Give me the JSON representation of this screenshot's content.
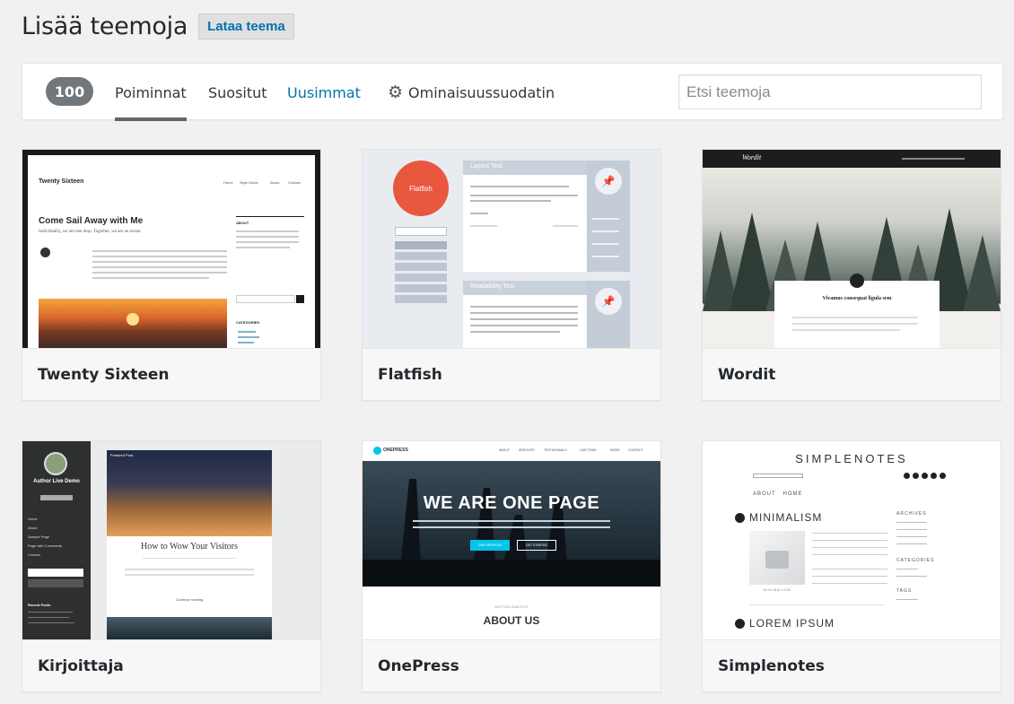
{
  "header": {
    "title": "Lisää teemoja",
    "upload_label": "Lataa teema"
  },
  "filter_bar": {
    "count": "100",
    "tabs": [
      {
        "label": "Poiminnat",
        "active": true
      },
      {
        "label": "Suositut",
        "active": false
      },
      {
        "label": "Uusimmat",
        "active": false
      },
      {
        "label": "Ominaisuussuodatin",
        "active": false
      }
    ],
    "search_placeholder": "Etsi teemoja"
  },
  "themes": [
    {
      "name": "Twenty Sixteen",
      "shot": {
        "site_title": "Twenty Sixteen",
        "nav": [
          "Home",
          "Style Guide",
          "About",
          "Contact"
        ],
        "headline": "Come Sail Away with Me",
        "tagline": "Individually, we are one drop. Together, we are an ocean.",
        "about": "ABOUT",
        "categories": "CATEGORIES"
      }
    },
    {
      "name": "Flatfish",
      "shot": {
        "logo": "Flatfish",
        "box1_title": "Layout Test",
        "box2_title": "Readability Test"
      }
    },
    {
      "name": "Wordit",
      "shot": {
        "logo": "Wordit",
        "post_title": "Vivamus consequat ligula sem"
      }
    },
    {
      "name": "Kirjoittaja",
      "shot": {
        "author": "Author Live Demo",
        "menu": [
          "Home",
          "About",
          "Sample Page",
          "Page with Comments",
          "Contact"
        ],
        "recent": "Recent Posts",
        "featured": "Featured Post",
        "headline": "How to Wow Your Visitors",
        "continue": "Continue reading"
      }
    },
    {
      "name": "OnePress",
      "shot": {
        "logo": "ONEPRESS",
        "nav": [
          "ABOUT",
          "SERVICES",
          "TESTIMONIALS",
          "OUR TEAM",
          "NEWS",
          "CONTACT"
        ],
        "hero": "WE ARE ONE PAGE",
        "btn1": "OUR SERVICES",
        "btn2": "GET STARTED",
        "section_sub": "SECTION SUBTITLE",
        "section": "ABOUT US"
      }
    },
    {
      "name": "Simplenotes",
      "shot": {
        "logo": "SIMPLENOTES",
        "nav": "ABOUT   HOME",
        "post1": "MINIMALISM",
        "post2": "LOREM IPSUM",
        "archives": "ARCHIVES",
        "categories": "CATEGORIES",
        "tags": "TAGS",
        "caption": "MINIMALISM"
      }
    }
  ],
  "colors": {
    "accent": "#0073aa",
    "badge": "#72777c",
    "flatfish_orange": "#e9573f",
    "onepress_cyan": "#03c4eb"
  }
}
